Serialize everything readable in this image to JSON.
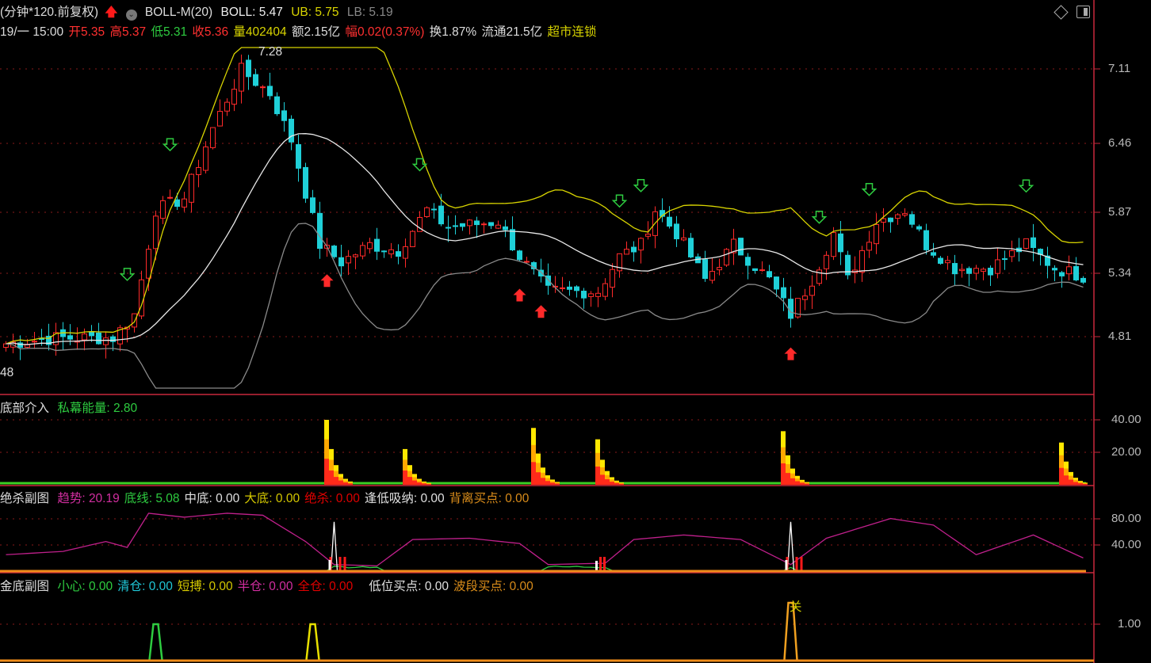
{
  "header": {
    "period": "(分钟*120.前复权)",
    "indicator": "BOLL-M(20)",
    "boll": "BOLL: 5.47",
    "ub": "UB: 5.75",
    "lb": "LB: 5.19",
    "date": "19/一 15:00",
    "open": "开5.35",
    "high": "高5.37",
    "low": "低5.31",
    "close": "收5.36",
    "volume": "量402404",
    "amount": "额2.15亿",
    "change": "幅0.02(0.37%)",
    "turnover": "换1.87%",
    "float": "流通21.5亿",
    "sector": "超市连锁"
  },
  "price_panel": {
    "high_label": "7.28",
    "low_label": "48",
    "axis": [
      "7.11",
      "6.46",
      "5.87",
      "5.34",
      "4.81"
    ]
  },
  "panel1": {
    "title": "底部介入",
    "value": "私幕能量: 2.80",
    "axis": [
      "40.00",
      "20.00"
    ]
  },
  "panel2": {
    "title": "绝杀副图",
    "items": [
      {
        "t": "趋势: 20.19",
        "c": "#d22ea0"
      },
      {
        "t": "底线: 5.08",
        "c": "#2ecc40"
      },
      {
        "t": "中底: 0.00",
        "c": "#e0e0e0"
      },
      {
        "t": "大底: 0.00",
        "c": "#d4c800"
      },
      {
        "t": "绝杀: 0.00",
        "c": "#e00000"
      },
      {
        "t": "逢低吸纳: 0.00",
        "c": "#e0e0e0"
      },
      {
        "t": "背离买点: 0.00",
        "c": "#d98c1a"
      }
    ],
    "axis": [
      "80.00",
      "40.00"
    ]
  },
  "panel3": {
    "title": "金底副图",
    "items": [
      {
        "t": "小心: 0.00",
        "c": "#2ecc40"
      },
      {
        "t": "清仓: 0.00",
        "c": "#20c8d8"
      },
      {
        "t": "短搏: 0.00",
        "c": "#d4c800"
      },
      {
        "t": "半仓: 0.00",
        "c": "#d22ea0"
      },
      {
        "t": "全仓: 0.00",
        "c": "#e00000"
      },
      {
        "t": "低位买点: 0.00",
        "c": "#e0e0e0"
      },
      {
        "t": "波段买点: 0.00",
        "c": "#d98c1a"
      }
    ],
    "axis": [
      "1.00"
    ],
    "marker": "关"
  },
  "colors": {
    "up": "#ff2a2a",
    "down": "#1fd0d8",
    "mid": "#e8e8e8",
    "upper": "#d8d400",
    "lower": "#8a8a8a",
    "grid": "#8a1a1a",
    "frame": "#c8283c"
  },
  "chart_data": {
    "type": "candlestick",
    "price_range": [
      4.5,
      7.4
    ],
    "close_keypoints": [
      [
        0,
        4.75
      ],
      [
        7,
        4.8
      ],
      [
        15,
        4.8
      ],
      [
        18,
        5.0
      ],
      [
        21,
        5.9
      ],
      [
        25,
        6.0
      ],
      [
        29,
        6.6
      ],
      [
        33,
        7.1
      ],
      [
        37,
        6.9
      ],
      [
        40,
        6.5
      ],
      [
        44,
        5.6
      ],
      [
        47,
        5.45
      ],
      [
        51,
        5.6
      ],
      [
        55,
        5.55
      ],
      [
        59,
        5.9
      ],
      [
        62,
        5.75
      ],
      [
        69,
        5.8
      ],
      [
        72,
        5.5
      ],
      [
        76,
        5.2
      ],
      [
        83,
        5.2
      ],
      [
        86,
        5.5
      ],
      [
        89,
        5.6
      ],
      [
        91,
        5.9
      ],
      [
        94,
        5.7
      ],
      [
        98,
        5.3
      ],
      [
        102,
        5.6
      ],
      [
        107,
        5.3
      ],
      [
        110,
        5.0
      ],
      [
        113,
        5.3
      ],
      [
        116,
        5.7
      ],
      [
        118,
        5.3
      ],
      [
        122,
        5.8
      ],
      [
        126,
        5.9
      ],
      [
        129,
        5.6
      ],
      [
        133,
        5.4
      ],
      [
        138,
        5.4
      ],
      [
        143,
        5.6
      ],
      [
        147,
        5.4
      ],
      [
        151,
        5.33
      ]
    ],
    "sell_arrows": [
      17,
      23,
      58,
      86,
      89,
      114,
      121,
      143
    ],
    "buy_arrows": [
      45,
      72,
      75,
      110
    ],
    "panel1_spikes": [
      [
        45,
        40
      ],
      [
        56,
        22
      ],
      [
        74,
        35
      ],
      [
        83,
        28
      ],
      [
        109,
        33
      ],
      [
        148,
        26
      ]
    ],
    "panel2_trend": [
      [
        0,
        25
      ],
      [
        8,
        30
      ],
      [
        14,
        45
      ],
      [
        17,
        36
      ],
      [
        20,
        88
      ],
      [
        25,
        82
      ],
      [
        31,
        88
      ],
      [
        36,
        85
      ],
      [
        42,
        45
      ],
      [
        46,
        10
      ],
      [
        52,
        8
      ],
      [
        57,
        48
      ],
      [
        65,
        50
      ],
      [
        72,
        42
      ],
      [
        76,
        10
      ],
      [
        84,
        12
      ],
      [
        88,
        48
      ],
      [
        95,
        55
      ],
      [
        103,
        48
      ],
      [
        110,
        10
      ],
      [
        115,
        50
      ],
      [
        124,
        80
      ],
      [
        130,
        70
      ],
      [
        136,
        25
      ],
      [
        144,
        55
      ],
      [
        151,
        20
      ]
    ],
    "panel2_spikes": [
      [
        46,
        75
      ],
      [
        110,
        75
      ]
    ],
    "panel3_spikes": [
      [
        21,
        1.0,
        "#2ecc40"
      ],
      [
        43,
        1.0,
        "#e8e000"
      ],
      [
        110,
        1.6,
        "#f0a020"
      ]
    ]
  }
}
